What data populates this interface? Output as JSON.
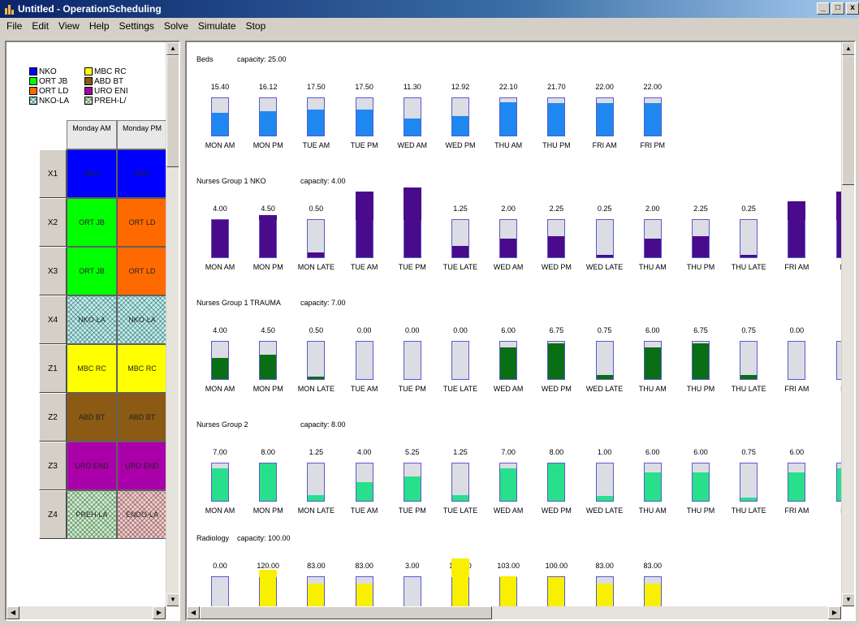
{
  "window": {
    "title": "Untitled - OperationScheduling",
    "controls": [
      "_",
      "&#9633;",
      "x"
    ]
  },
  "menu": [
    "File",
    "Edit",
    "View",
    "Help",
    "Settings",
    "Solve",
    "Simulate",
    "Stop"
  ],
  "legend": [
    {
      "label": "NKO",
      "color": "#0000ff",
      "pattern": "solid"
    },
    {
      "label": "MBC RC",
      "color": "#ffff00",
      "pattern": "solid"
    },
    {
      "label": "ORT JB",
      "color": "#00ff00",
      "pattern": "solid"
    },
    {
      "label": "ABD BT",
      "color": "#8b5a14",
      "pattern": "solid"
    },
    {
      "label": "ORT LD",
      "color": "#ff6a00",
      "pattern": "solid"
    },
    {
      "label": "URO ENI",
      "color": "#aa00aa",
      "pattern": "solid"
    },
    {
      "label": "NKO-LA",
      "color": "#b8f0f0",
      "pattern": "hatch"
    },
    {
      "label": "PREH-L/",
      "color": "#c8f0c8",
      "pattern": "hatch"
    }
  ],
  "schedule": {
    "columns": [
      "Monday AM",
      "Monday PM"
    ],
    "rows": [
      {
        "label": "X1",
        "cells": [
          {
            "text": "NKO",
            "color": "#0000ff",
            "pattern": "solid"
          },
          {
            "text": "NKO",
            "color": "#0000ff",
            "pattern": "solid"
          }
        ]
      },
      {
        "label": "X2",
        "cells": [
          {
            "text": "ORT JB",
            "color": "#00ff00",
            "pattern": "solid"
          },
          {
            "text": "ORT LD",
            "color": "#ff6a00",
            "pattern": "solid"
          }
        ]
      },
      {
        "label": "X3",
        "cells": [
          {
            "text": "ORT JB",
            "color": "#00ff00",
            "pattern": "solid"
          },
          {
            "text": "ORT LD",
            "color": "#ff6a00",
            "pattern": "solid"
          }
        ]
      },
      {
        "label": "X4",
        "cells": [
          {
            "text": "NKO-LA",
            "color": "#b8f0f0",
            "pattern": "hatch"
          },
          {
            "text": "NKO-LA",
            "color": "#b8f0f0",
            "pattern": "hatch"
          }
        ]
      },
      {
        "label": "Z1",
        "cells": [
          {
            "text": "MBC RC",
            "color": "#ffff00",
            "pattern": "solid"
          },
          {
            "text": "MBC RC",
            "color": "#ffff00",
            "pattern": "solid"
          }
        ]
      },
      {
        "label": "Z2",
        "cells": [
          {
            "text": "ABD BT",
            "color": "#8b5a14",
            "pattern": "solid"
          },
          {
            "text": "ABD BT",
            "color": "#8b5a14",
            "pattern": "solid"
          }
        ]
      },
      {
        "label": "Z3",
        "cells": [
          {
            "text": "URO END",
            "color": "#aa00aa",
            "pattern": "solid"
          },
          {
            "text": "URO END",
            "color": "#aa00aa",
            "pattern": "solid"
          }
        ]
      },
      {
        "label": "Z4",
        "cells": [
          {
            "text": "PREH-LA",
            "color": "#c8f0c8",
            "pattern": "hatch"
          },
          {
            "text": "ENDO-LA",
            "color": "#f8c8c8",
            "pattern": "hatch"
          }
        ]
      }
    ]
  },
  "charts": [
    {
      "name": "Beds",
      "capacity_label": "capacity: 25.00",
      "capacity": 25,
      "color": "#1e88f0",
      "bars": [
        {
          "label": "MON AM",
          "value": 15.4
        },
        {
          "label": "MON PM",
          "value": 16.12
        },
        {
          "label": "TUE AM",
          "value": 17.5
        },
        {
          "label": "TUE PM",
          "value": 17.5
        },
        {
          "label": "WED AM",
          "value": 11.3
        },
        {
          "label": "WED PM",
          "value": 12.92
        },
        {
          "label": "THU AM",
          "value": 22.1
        },
        {
          "label": "THU PM",
          "value": 21.7
        },
        {
          "label": "FRI AM",
          "value": 22.0
        },
        {
          "label": "FRI PM",
          "value": 22.0
        }
      ],
      "value_texts": [
        "15.40",
        "16.12",
        "17.50",
        "17.50",
        "11.30",
        "12.92",
        "22.10",
        "21.70",
        "22.00",
        "22.00"
      ]
    },
    {
      "name": "Nurses Group 1 NKO",
      "capacity_label": "capacity: 4.00",
      "capacity": 4,
      "color": "#4a0a8c",
      "bars": [
        {
          "label": "MON AM",
          "value": 4.0
        },
        {
          "label": "MON PM",
          "value": 4.5
        },
        {
          "label": "MON LATE",
          "value": 0.5
        },
        {
          "label": "TUE AM",
          "value": 7.0
        },
        {
          "label": "TUE PM",
          "value": 8.25
        },
        {
          "label": "TUE LATE",
          "value": 1.25
        },
        {
          "label": "WED AM",
          "value": 2.0
        },
        {
          "label": "WED PM",
          "value": 2.25
        },
        {
          "label": "WED LATE",
          "value": 0.25
        },
        {
          "label": "THU AM",
          "value": 2.0
        },
        {
          "label": "THU PM",
          "value": 2.25
        },
        {
          "label": "THU LATE",
          "value": 0.25
        },
        {
          "label": "FRI AM",
          "value": 6.0
        },
        {
          "label": "FR",
          "value": 7.0
        }
      ],
      "value_texts": [
        "4.00",
        "4.50",
        "0.50",
        "7.00",
        "8.25",
        "1.25",
        "2.00",
        "2.25",
        "0.25",
        "2.00",
        "2.25",
        "0.25",
        "6.00",
        "7."
      ]
    },
    {
      "name": "Nurses Group 1 TRAUMA",
      "capacity_label": "capacity: 7.00",
      "capacity": 7,
      "color": "#0a6e14",
      "bars": [
        {
          "label": "MON AM",
          "value": 4.0
        },
        {
          "label": "MON PM",
          "value": 4.5
        },
        {
          "label": "MON LATE",
          "value": 0.5
        },
        {
          "label": "TUE AM",
          "value": 0.0
        },
        {
          "label": "TUE PM",
          "value": 0.0
        },
        {
          "label": "TUE LATE",
          "value": 0.0
        },
        {
          "label": "WED AM",
          "value": 6.0
        },
        {
          "label": "WED PM",
          "value": 6.75
        },
        {
          "label": "WED LATE",
          "value": 0.75
        },
        {
          "label": "THU AM",
          "value": 6.0
        },
        {
          "label": "THU PM",
          "value": 6.75
        },
        {
          "label": "THU LATE",
          "value": 0.75
        },
        {
          "label": "FRI AM",
          "value": 0.0
        },
        {
          "label": "FF",
          "value": 0.0
        }
      ],
      "value_texts": [
        "4.00",
        "4.50",
        "0.50",
        "0.00",
        "0.00",
        "0.00",
        "6.00",
        "6.75",
        "0.75",
        "6.00",
        "6.75",
        "0.75",
        "0.00",
        "0."
      ]
    },
    {
      "name": "Nurses Group 2",
      "capacity_label": "capacity: 8.00",
      "capacity": 8,
      "color": "#28e08c",
      "bars": [
        {
          "label": "MON AM",
          "value": 7.0
        },
        {
          "label": "MON PM",
          "value": 8.0
        },
        {
          "label": "MON LATE",
          "value": 1.25
        },
        {
          "label": "TUE AM",
          "value": 4.0
        },
        {
          "label": "TUE PM",
          "value": 5.25
        },
        {
          "label": "TUE LATE",
          "value": 1.25
        },
        {
          "label": "WED AM",
          "value": 7.0
        },
        {
          "label": "WED PM",
          "value": 8.0
        },
        {
          "label": "WED LATE",
          "value": 1.0
        },
        {
          "label": "THU AM",
          "value": 6.0
        },
        {
          "label": "THU PM",
          "value": 6.0
        },
        {
          "label": "THU LATE",
          "value": 0.75
        },
        {
          "label": "FRI AM",
          "value": 6.0
        },
        {
          "label": "FF",
          "value": 7.0
        }
      ],
      "value_texts": [
        "7.00",
        "8.00",
        "1.25",
        "4.00",
        "5.25",
        "1.25",
        "7.00",
        "8.00",
        "1.00",
        "6.00",
        "6.00",
        "0.75",
        "6.00",
        "7."
      ]
    },
    {
      "name": "Radiology",
      "capacity_label": "capacity: 100.00",
      "capacity": 100,
      "color": "#f8f000",
      "bars": [
        {
          "label": "",
          "value": 0.0
        },
        {
          "label": "",
          "value": 120.0
        },
        {
          "label": "",
          "value": 83.0
        },
        {
          "label": "",
          "value": 83.0
        },
        {
          "label": "",
          "value": 3.0
        },
        {
          "label": "",
          "value": 150.0
        },
        {
          "label": "",
          "value": 103.0
        },
        {
          "label": "",
          "value": 100.0
        },
        {
          "label": "",
          "value": 83.0
        },
        {
          "label": "",
          "value": 83.0
        }
      ],
      "value_texts": [
        "0.00",
        "120.00",
        "83.00",
        "83.00",
        "3.00",
        "150.00",
        "103.00",
        "100.00",
        "83.00",
        "83.00"
      ]
    }
  ]
}
